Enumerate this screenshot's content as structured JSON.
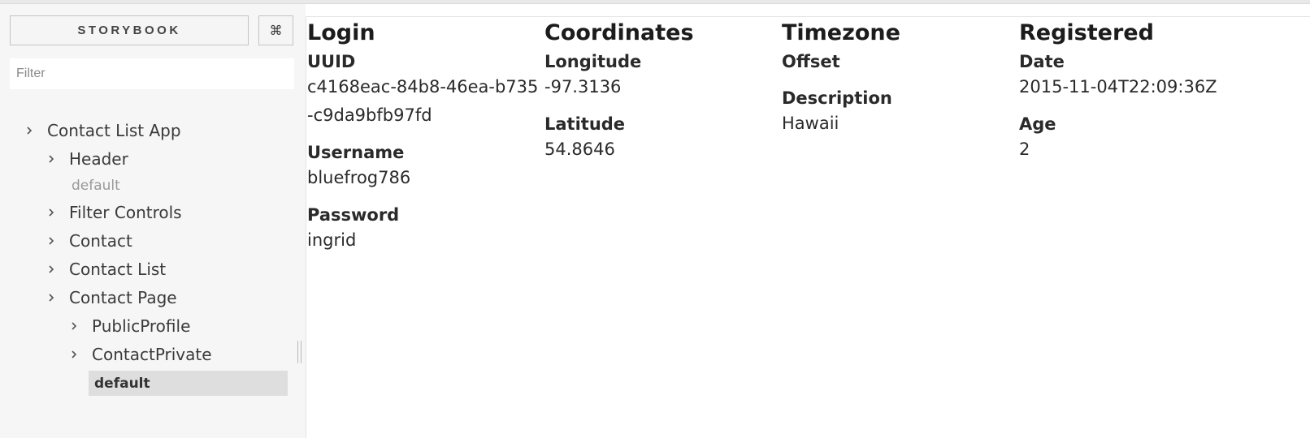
{
  "sidebar": {
    "brand": "STORYBOOK",
    "shortcut": "⌘",
    "filter_placeholder": "Filter",
    "tree": {
      "root": "Contact List App",
      "header": "Header",
      "header_story": "default",
      "filter_controls": "Filter Controls",
      "contact": "Contact",
      "contact_list": "Contact List",
      "contact_page": "Contact Page",
      "public_profile": "PublicProfile",
      "contact_private": "ContactPrivate",
      "selected_story": "default"
    }
  },
  "preview": {
    "login": {
      "heading": "Login",
      "uuid_label": "UUID",
      "uuid_value": "c4168eac-84b8-46ea-b735-c9da9bfb97fd",
      "username_label": "Username",
      "username_value": "bluefrog786",
      "password_label": "Password",
      "password_value": "ingrid"
    },
    "coordinates": {
      "heading": "Coordinates",
      "longitude_label": "Longitude",
      "longitude_value": "-97.3136",
      "latitude_label": "Latitude",
      "latitude_value": "54.8646"
    },
    "timezone": {
      "heading": "Timezone",
      "offset_label": "Offset",
      "offset_value": "",
      "description_label": "Description",
      "description_value": "Hawaii"
    },
    "registered": {
      "heading": "Registered",
      "date_label": "Date",
      "date_value": "2015-11-04T22:09:36Z",
      "age_label": "Age",
      "age_value": "2"
    }
  }
}
